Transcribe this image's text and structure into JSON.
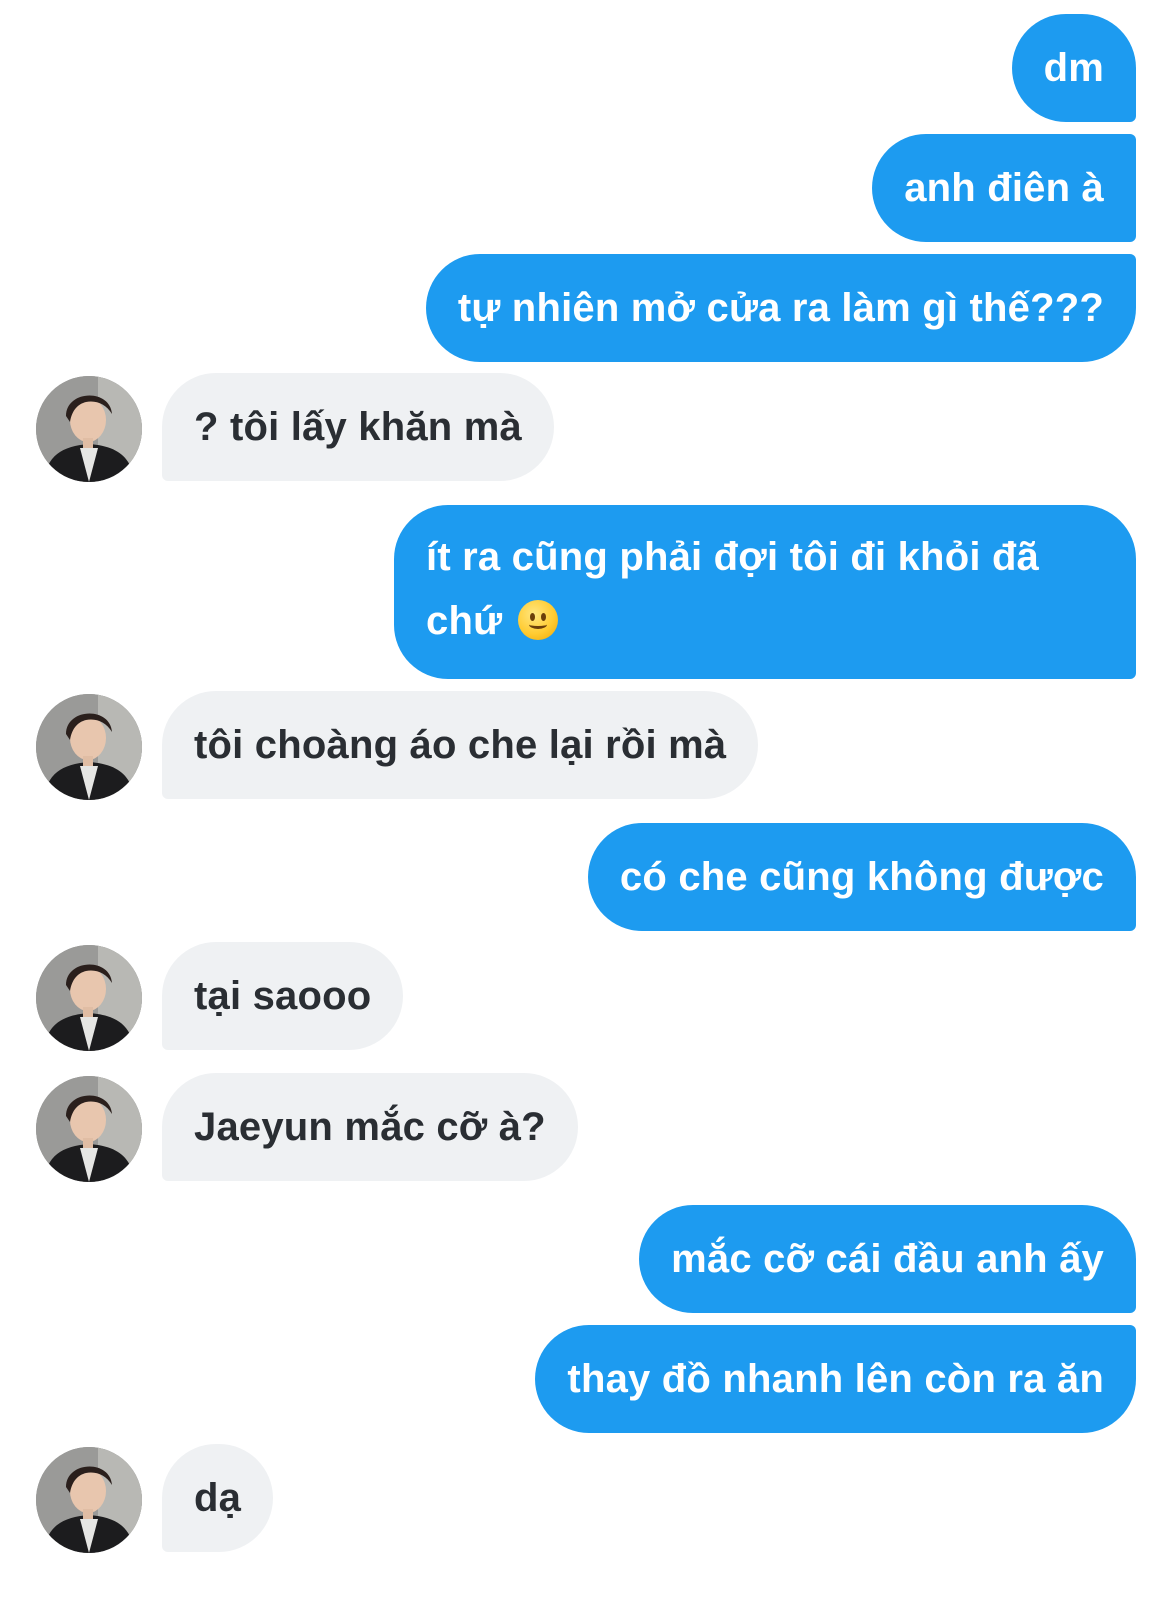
{
  "messages": [
    {
      "id": 1,
      "direction": "sent",
      "text": "dm"
    },
    {
      "id": 2,
      "direction": "sent",
      "text": "anh điên à"
    },
    {
      "id": 3,
      "direction": "sent",
      "text": "tự nhiên mở cửa ra làm gì thế???"
    },
    {
      "id": 4,
      "direction": "received",
      "text": "? tôi lấy khăn mà"
    },
    {
      "id": 5,
      "direction": "sent",
      "text": "ít ra cũng phải đợi tôi đi khỏi đã chứ",
      "emoji": "slightly-smiling-face-icon"
    },
    {
      "id": 6,
      "direction": "received",
      "text": "tôi choàng áo che lại rồi mà"
    },
    {
      "id": 7,
      "direction": "sent",
      "text": "có che cũng không được"
    },
    {
      "id": 8,
      "direction": "received",
      "text": "tại saooo"
    },
    {
      "id": 9,
      "direction": "received",
      "text": "Jaeyun mắc cỡ à?"
    },
    {
      "id": 10,
      "direction": "sent",
      "text": "mắc cỡ cái đầu anh ấy"
    },
    {
      "id": 11,
      "direction": "sent",
      "text": "thay đồ nhanh lên còn ra ăn"
    },
    {
      "id": 12,
      "direction": "received",
      "text": "dạ"
    }
  ],
  "colors": {
    "sent_bubble": "#1d9bf0",
    "sent_text": "#ffffff",
    "received_bubble": "#eff1f3",
    "received_text": "#2a2e33",
    "background": "#ffffff"
  },
  "avatar_icon": "user-avatar"
}
